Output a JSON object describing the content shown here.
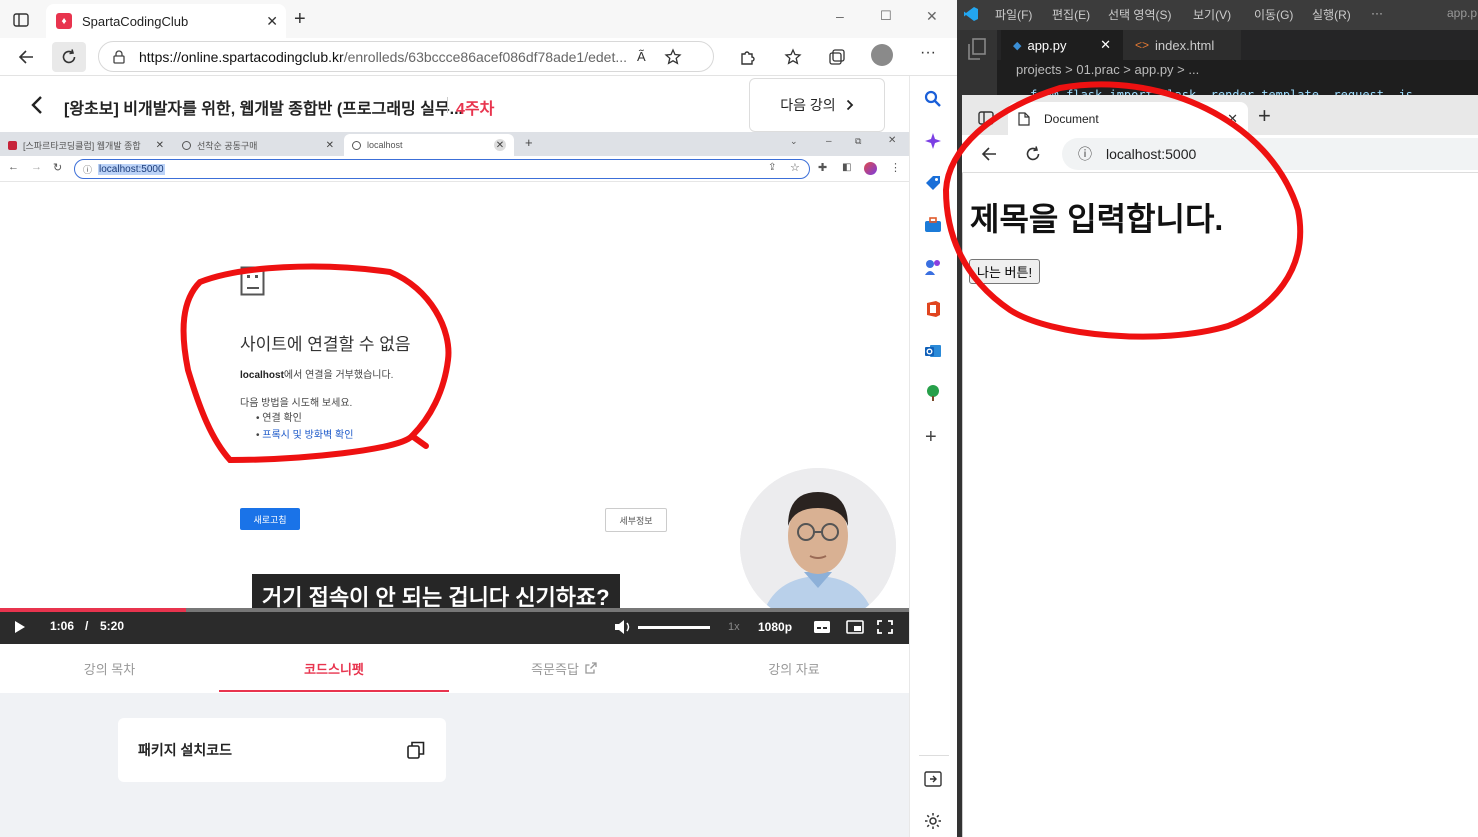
{
  "edge": {
    "tab_title": "SpartaCodingClub",
    "tab_favicon": "sparta-logo",
    "new_tab": "+",
    "url_host": "https://online.spartacodingclub.kr",
    "url_rest": "/enrolleds/63bccce86acef086df78ade1/edet...",
    "window_controls": [
      "–",
      "☐",
      "✕"
    ]
  },
  "course": {
    "title": "[왕초보] 비개발자를 위한, 웹개발 종합반 (프로그래밍 실무...",
    "week": "4주차",
    "next_label": "다음 강의"
  },
  "video": {
    "inner_tabs": [
      "[스파르타코딩클럽] 웹개발 종합",
      "선착순 공동구매",
      "localhost"
    ],
    "inner_url": "localhost:5000",
    "error": {
      "title": "사이트에 연결할 수 없음",
      "host": "localhost",
      "desc_rest": "에서 연결을 거부했습니다.",
      "try_label": "다음 방법을 시도해 보세요.",
      "items": [
        "연결 확인",
        "프록시 및 방화벽 확인"
      ],
      "reload": "새로고침",
      "details": "세부정보"
    },
    "subtitle": "거기 접속이 안 되는 겁니다 신기하죠?",
    "current_time": "1:06",
    "separator": "/",
    "duration": "5:20",
    "progress": 0.205,
    "speed": "1x",
    "quality": "1080p"
  },
  "lesson_tabs": [
    {
      "label": "강의 목차",
      "active": false
    },
    {
      "label": "코드스니펫",
      "active": true
    },
    {
      "label": "즉문즉답",
      "active": false
    },
    {
      "label": "강의 자료",
      "active": false
    }
  ],
  "snippet": {
    "title": "패키지 설치코드"
  },
  "vscode": {
    "menu": [
      "파일(F)",
      "편집(E)",
      "선택 영역(S)",
      "보기(V)",
      "이동(G)",
      "실행(R)",
      "···",
      "app.p"
    ],
    "tabs": [
      "app.py",
      "index.html"
    ],
    "breadcrumb": "projects > 01.prac > app.py > ...",
    "code_peek": "from flask import Flask, render_template, request, js"
  },
  "nested_browser": {
    "tab_title": "Document",
    "url": "localhost:5000",
    "heading": "제목을 입력합니다.",
    "button_label": "나는 버튼!"
  },
  "colors": {
    "accent_red": "#e8344e",
    "annotation_red": "#ee1111",
    "chrome_blue": "#1a73e8"
  }
}
